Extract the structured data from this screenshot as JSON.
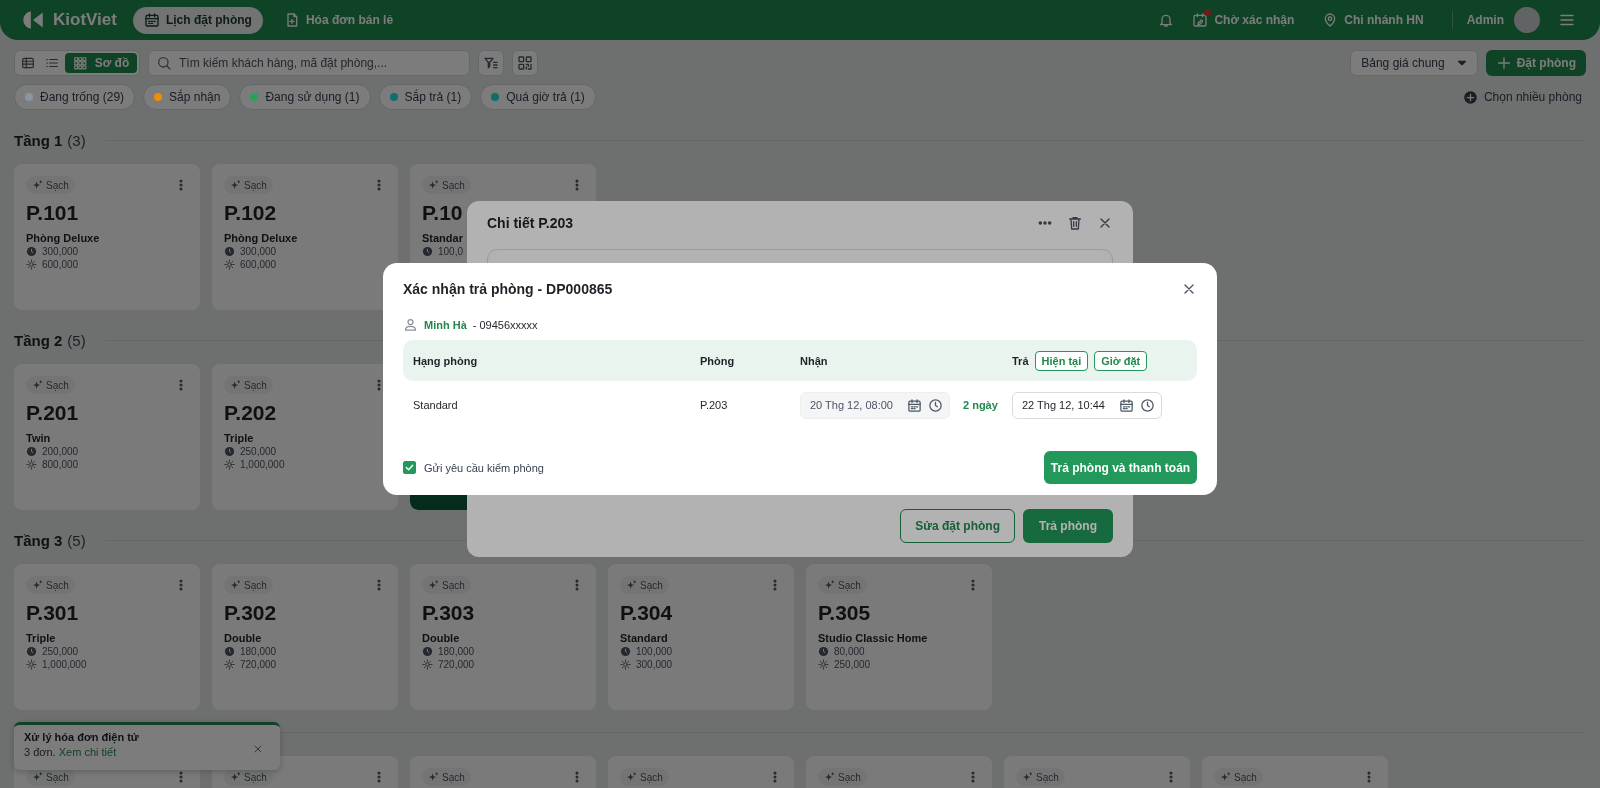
{
  "header": {
    "logo": "KiotViet",
    "nav": [
      {
        "label": "Lịch đặt phòng",
        "selected": true
      },
      {
        "label": "Hóa đơn bán lẻ",
        "selected": false
      }
    ],
    "pending": {
      "label": "Chờ xác nhận",
      "has_badge": true
    },
    "branch": "Chi nhánh HN",
    "user": "Admin"
  },
  "toolbar": {
    "views": [
      {
        "kind": "table",
        "selected": false
      },
      {
        "kind": "list",
        "selected": false
      },
      {
        "kind": "grid",
        "label": "Sơ đồ",
        "selected": true
      }
    ],
    "search": {
      "placeholder": "Tìm kiếm khách hàng, mã đặt phòng,..."
    },
    "price_list": "Bảng giá chung",
    "book_button": "Đặt phòng"
  },
  "filters": [
    {
      "label": "Đang trống (29)",
      "color": "#8a94a3"
    },
    {
      "label": "Sắp nhận",
      "color": "#f08c00"
    },
    {
      "label": "Đang sử dụng (1)",
      "color": "#2f9e5b"
    },
    {
      "label": "Sắp trả (1)",
      "color": "#0f6f6c"
    },
    {
      "label": "Quá giờ trả (1)",
      "color": "#0f6f6c"
    }
  ],
  "multi_select": "Chọn nhiều phòng",
  "floors": [
    {
      "title": "Tầng 1",
      "count": "(3)",
      "rooms": [
        {
          "kind": "room",
          "status": "Sạch",
          "name": "P.101",
          "type": "Phòng Deluxe",
          "hour_price": "300,000",
          "day_price": "600,000"
        },
        {
          "kind": "room",
          "status": "Sạch",
          "name": "P.102",
          "type": "Phòng Deluxe",
          "hour_price": "300,000",
          "day_price": "600,000"
        },
        {
          "kind": "room",
          "status": "Sạch",
          "name": "P.10",
          "type": "Standar",
          "hour_price": "100,0"
        }
      ]
    },
    {
      "title": "Tầng 2",
      "count": "(5)",
      "rooms": [
        {
          "kind": "room",
          "status": "Sạch",
          "name": "P.201",
          "type": "Twin",
          "hour_price": "200,000",
          "day_price": "800,000"
        },
        {
          "kind": "room",
          "status": "Sạch",
          "name": "P.202",
          "type": "Triple",
          "hour_price": "250,000",
          "day_price": "1,000,000"
        },
        {
          "kind": "occupied"
        }
      ]
    },
    {
      "title": "Tầng 3",
      "count": "(5)",
      "rooms": [
        {
          "kind": "room",
          "status": "Sạch",
          "name": "P.301",
          "type": "Triple",
          "hour_price": "250,000",
          "day_price": "1,000,000"
        },
        {
          "kind": "room",
          "status": "Sạch",
          "name": "P.302",
          "type": "Double",
          "hour_price": "180,000",
          "day_price": "720,000"
        },
        {
          "kind": "room",
          "status": "Sạch",
          "name": "P.303",
          "type": "Double",
          "hour_price": "180,000",
          "day_price": "720,000"
        },
        {
          "kind": "room",
          "status": "Sạch",
          "name": "P.304",
          "type": "Standard",
          "hour_price": "100,000",
          "day_price": "300,000"
        },
        {
          "kind": "room",
          "status": "Sạch",
          "name": "P.305",
          "type": "Studio Classic Home",
          "hour_price": "80,000",
          "day_price": "250,000"
        }
      ]
    },
    {
      "rooms": [
        {
          "kind": "room",
          "status": "Sạch"
        },
        {
          "kind": "room",
          "status": "Sạch"
        },
        {
          "kind": "room",
          "status": "Sạch"
        },
        {
          "kind": "room",
          "status": "Sạch"
        },
        {
          "kind": "room",
          "status": "Sạch"
        },
        {
          "kind": "room",
          "status": "Sạch"
        },
        {
          "kind": "room",
          "status": "Sạch"
        }
      ]
    }
  ],
  "toast": {
    "title": "Xử lý hóa đơn điện tử",
    "message": "3 đơn.",
    "link": "Xem chi tiết"
  },
  "detail_dialog": {
    "title": "Chi tiết P.203",
    "buttons": [
      {
        "label": "Sửa đặt phòng",
        "kind": "outline"
      },
      {
        "label": "Trả phòng",
        "kind": "primary"
      }
    ]
  },
  "checkout_dialog": {
    "title": "Xác nhận trả phòng - DP000865",
    "guest_name": "Minh Hà",
    "guest_phone": "- 09456xxxxx",
    "columns": [
      "Hạng phòng",
      "Phòng",
      "Nhận",
      "Trả"
    ],
    "quick_buttons": [
      "Hiện tại",
      "Giờ đặt"
    ],
    "row": {
      "room_type": "Standard",
      "room": "P.203",
      "check_in": {
        "value": "20 Thg 12, 08:00",
        "disabled": true
      },
      "duration": "2 ngày",
      "check_out": {
        "value": "22 Thg 12, 10:44",
        "disabled": false
      }
    },
    "inspection": {
      "label": "Gửi yêu cầu kiểm phòng",
      "checked": true
    },
    "primary_button": "Trả phòng và thanh toán"
  }
}
